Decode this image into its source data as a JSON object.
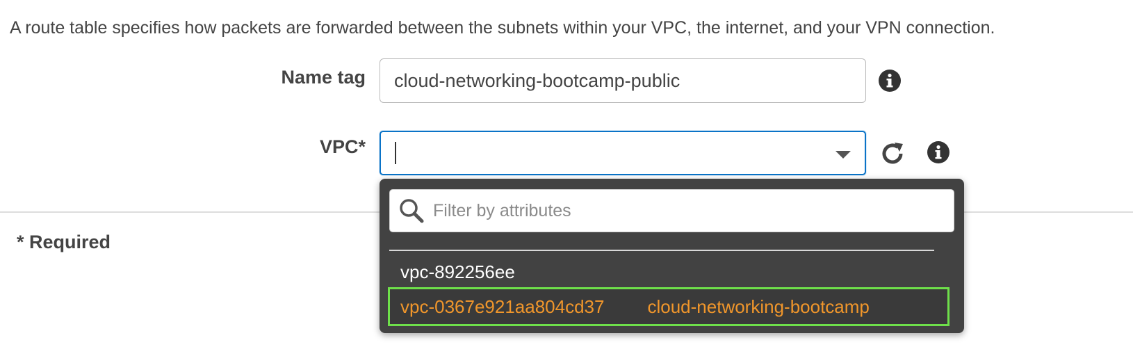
{
  "description": "A route table specifies how packets are forwarded between the subnets within your VPC, the internet, and your VPN connection.",
  "form": {
    "name_tag_label": "Name tag",
    "name_tag_value": "cloud-networking-bootcamp-public",
    "vpc_label": "VPC*",
    "vpc_value": ""
  },
  "required_note": "* Required",
  "dropdown": {
    "filter_placeholder": "Filter by attributes",
    "options": [
      {
        "id": "vpc-892256ee",
        "name": ""
      },
      {
        "id": "vpc-0367e921aa804cd37",
        "name": "cloud-networking-bootcamp",
        "highlighted": true
      }
    ]
  },
  "icons": {
    "info": "info-circle-icon",
    "refresh": "refresh-icon",
    "search": "search-icon",
    "dropdown": "triangle-down-icon"
  },
  "colors": {
    "focus_border": "#0a73c7",
    "dropdown_bg": "#424242",
    "highlight_text": "#f0962b",
    "highlight_outline": "#6ee04a"
  }
}
